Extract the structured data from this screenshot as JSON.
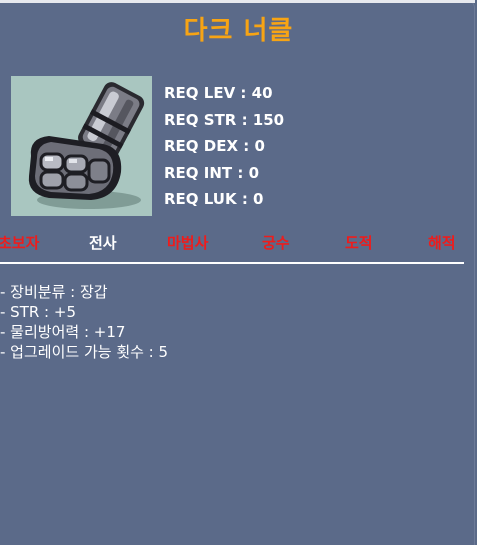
{
  "item": {
    "name": "다크 너클",
    "icon": "dark-knuckle-glove-icon"
  },
  "requirements": [
    {
      "label": "REQ LEV : 40"
    },
    {
      "label": "REQ STR : 150"
    },
    {
      "label": "REQ DEX : 0"
    },
    {
      "label": "REQ INT : 0"
    },
    {
      "label": "REQ LUK : 0"
    }
  ],
  "jobs": [
    {
      "label": "초보자",
      "color": "#ee1c1c"
    },
    {
      "label": "전사",
      "color": "#ffffff"
    },
    {
      "label": "마법사",
      "color": "#ee1c1c"
    },
    {
      "label": "궁수",
      "color": "#ee1c1c"
    },
    {
      "label": "도적",
      "color": "#ee1c1c"
    },
    {
      "label": "해적",
      "color": "#ee1c1c"
    }
  ],
  "stats": [
    {
      "label": "- 장비분류 : 장갑"
    },
    {
      "label": "- STR : +5"
    },
    {
      "label": "- 물리방어력 : +17"
    },
    {
      "label": "- 업그레이드 가능 횟수 : 5"
    }
  ],
  "colors": {
    "panel_bg": "#5b6a89",
    "title": "#f7a414",
    "icon_bg": "#a9c6c0",
    "not_eligible_job": "#ee1c1c",
    "eligible_job": "#ffffff"
  }
}
